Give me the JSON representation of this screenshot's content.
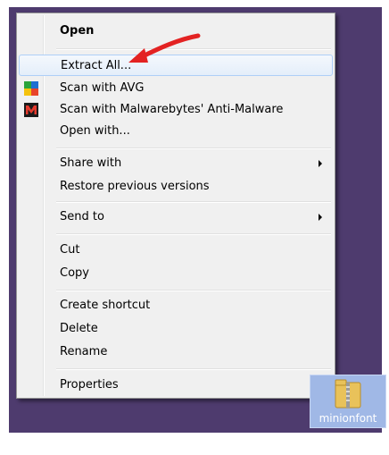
{
  "menu": {
    "items": [
      {
        "label": "Open"
      },
      {
        "label": "Extract All..."
      },
      {
        "label": "Scan with AVG",
        "icon": "avg-icon"
      },
      {
        "label": "Scan with Malwarebytes' Anti-Malware",
        "icon": "malwarebytes-icon"
      },
      {
        "label": "Open with..."
      },
      {
        "label": "Share with"
      },
      {
        "label": "Restore previous versions"
      },
      {
        "label": "Send to"
      },
      {
        "label": "Cut"
      },
      {
        "label": "Copy"
      },
      {
        "label": "Create shortcut"
      },
      {
        "label": "Delete"
      },
      {
        "label": "Rename"
      },
      {
        "label": "Properties"
      }
    ]
  },
  "file": {
    "name": "minionfont",
    "icon": "zip-folder-icon"
  },
  "annotation": {
    "type": "red-arrow",
    "color": "#e32222"
  },
  "colors": {
    "desktop": "#4e3b6e",
    "menu_bg": "#f0f0f0",
    "hover_border": "#aecff7",
    "selected_tile": "#a0b8e6"
  }
}
